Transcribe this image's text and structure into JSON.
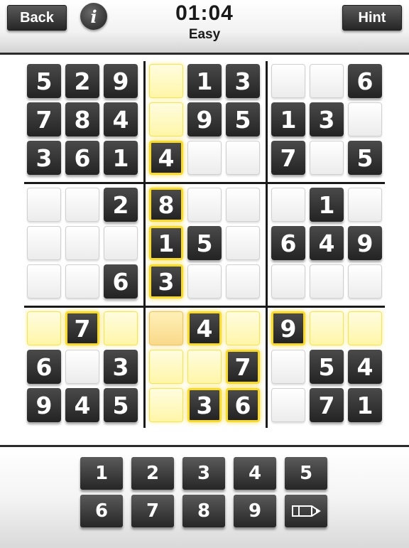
{
  "header": {
    "back_label": "Back",
    "info_icon": "info-icon",
    "timer": "01:04",
    "difficulty": "Easy",
    "hint_label": "Hint"
  },
  "board": {
    "rows": [
      [
        "5",
        "2",
        "9",
        "",
        "1",
        "3",
        "",
        "",
        "6"
      ],
      [
        "7",
        "8",
        "4",
        "",
        "9",
        "5",
        "1",
        "3",
        ""
      ],
      [
        "3",
        "6",
        "1",
        "4",
        "",
        "",
        "7",
        "",
        "5"
      ],
      [
        "",
        "",
        "2",
        "8",
        "",
        "",
        "",
        "1",
        ""
      ],
      [
        "",
        "",
        "",
        "1",
        "5",
        "",
        "6",
        "4",
        "9"
      ],
      [
        "",
        "",
        "6",
        "3",
        "",
        "",
        "",
        "",
        ""
      ],
      [
        "",
        "7",
        "",
        "",
        "4",
        "",
        "9",
        "",
        ""
      ],
      [
        "6",
        "",
        "3",
        "",
        "",
        "7",
        "",
        "5",
        "4"
      ],
      [
        "9",
        "4",
        "5",
        "",
        "3",
        "6",
        "",
        "7",
        "1"
      ]
    ],
    "selected": {
      "row": 6,
      "col": 3
    },
    "highlight_color": "#f7da2a"
  },
  "keypad": {
    "row1": [
      "1",
      "2",
      "3",
      "4",
      "5"
    ],
    "row2": [
      "6",
      "7",
      "8",
      "9"
    ],
    "pencil_icon": "pencil-icon"
  },
  "colors": {
    "tile_dark": "#2f2f2f",
    "tile_light": "#f3f3f3",
    "highlight": "#fff6a8"
  }
}
